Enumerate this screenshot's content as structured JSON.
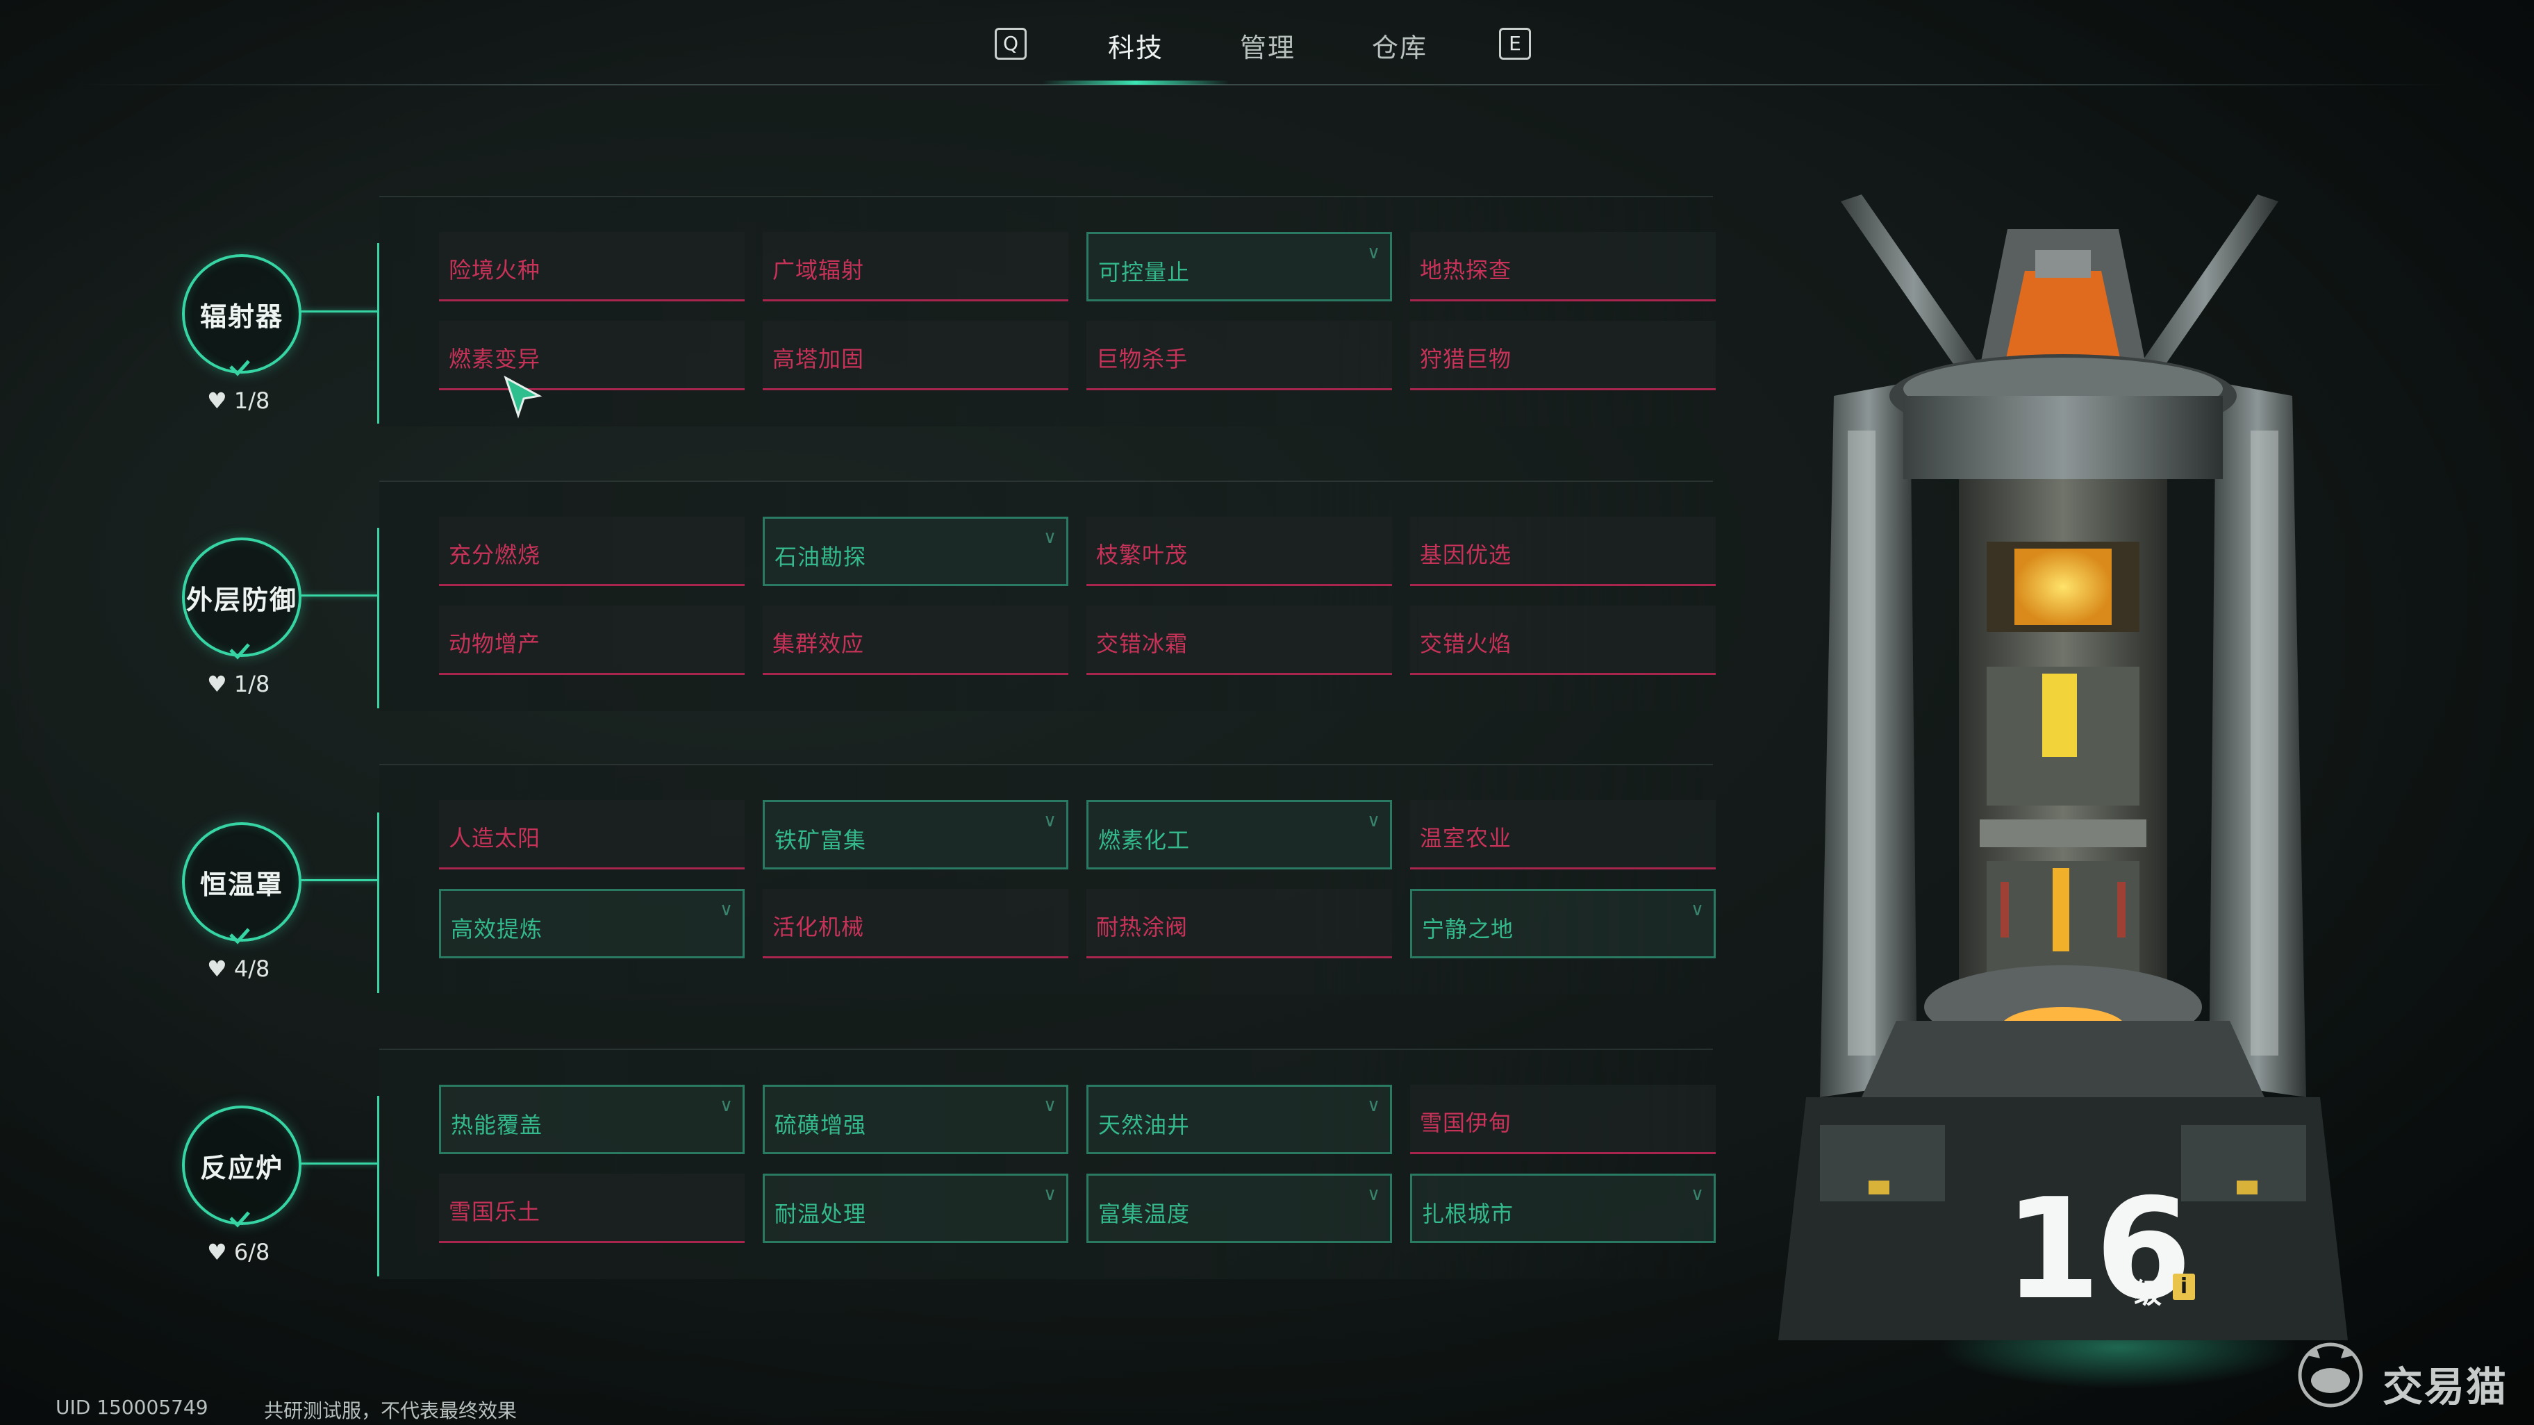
{
  "nav": {
    "left_key": "Q",
    "right_key": "E",
    "tabs": [
      {
        "label": "科技",
        "active": true
      },
      {
        "label": "管理",
        "active": false
      },
      {
        "label": "仓库",
        "active": false
      }
    ]
  },
  "categories": [
    {
      "name": "辐射器",
      "count": "1/8",
      "techs": [
        {
          "label": "险境火种",
          "unlocked": false
        },
        {
          "label": "广域辐射",
          "unlocked": false
        },
        {
          "label": "可控量止",
          "unlocked": true
        },
        {
          "label": "地热探查",
          "unlocked": false
        },
        {
          "label": "燃素变异",
          "unlocked": false
        },
        {
          "label": "高塔加固",
          "unlocked": false
        },
        {
          "label": "巨物杀手",
          "unlocked": false
        },
        {
          "label": "狩猎巨物",
          "unlocked": false
        }
      ]
    },
    {
      "name": "外层防御",
      "count": "1/8",
      "techs": [
        {
          "label": "充分燃烧",
          "unlocked": false
        },
        {
          "label": "石油勘探",
          "unlocked": true
        },
        {
          "label": "枝繁叶茂",
          "unlocked": false
        },
        {
          "label": "基因优选",
          "unlocked": false
        },
        {
          "label": "动物增产",
          "unlocked": false
        },
        {
          "label": "集群效应",
          "unlocked": false
        },
        {
          "label": "交错冰霜",
          "unlocked": false
        },
        {
          "label": "交错火焰",
          "unlocked": false
        }
      ]
    },
    {
      "name": "恒温罩",
      "count": "4/8",
      "techs": [
        {
          "label": "人造太阳",
          "unlocked": false
        },
        {
          "label": "铁矿富集",
          "unlocked": true
        },
        {
          "label": "燃素化工",
          "unlocked": true
        },
        {
          "label": "温室农业",
          "unlocked": false
        },
        {
          "label": "高效提炼",
          "unlocked": true
        },
        {
          "label": "活化机械",
          "unlocked": false
        },
        {
          "label": "耐热涂阀",
          "unlocked": false
        },
        {
          "label": "宁静之地",
          "unlocked": true
        }
      ]
    },
    {
      "name": "反应炉",
      "count": "6/8",
      "techs": [
        {
          "label": "热能覆盖",
          "unlocked": true
        },
        {
          "label": "硫磺增强",
          "unlocked": true
        },
        {
          "label": "天然油井",
          "unlocked": true
        },
        {
          "label": "雪国伊甸",
          "unlocked": false
        },
        {
          "label": "雪国乐土",
          "unlocked": false
        },
        {
          "label": "耐温处理",
          "unlocked": true
        },
        {
          "label": "富集温度",
          "unlocked": true
        },
        {
          "label": "扎根城市",
          "unlocked": true
        }
      ]
    }
  ],
  "level": {
    "value": "16",
    "unit": "级",
    "info": "i"
  },
  "footer": {
    "uid": "UID 150005749",
    "note": "共研测试服，不代表最终效果"
  },
  "watermark": {
    "text": "交易猫"
  },
  "colors": {
    "accent": "#37d4a4",
    "locked": "#c73259",
    "unlocked": "#34b98c"
  }
}
